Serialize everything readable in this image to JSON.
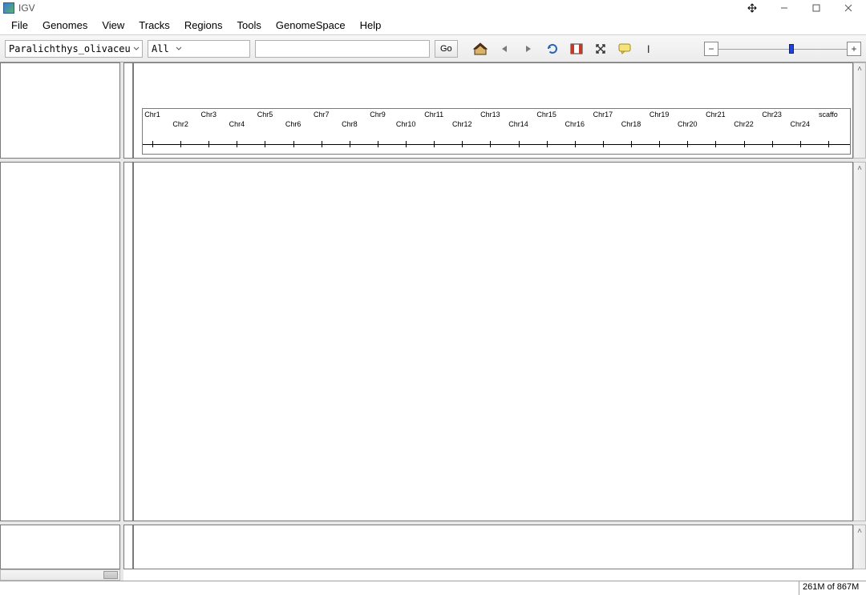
{
  "window": {
    "title": "IGV"
  },
  "menu": {
    "items": [
      "File",
      "Genomes",
      "View",
      "Tracks",
      "Regions",
      "Tools",
      "GenomeSpace",
      "Help"
    ]
  },
  "toolbar": {
    "genome_selected": "Paralichthys_olivaceus...",
    "chrom_selected": "All",
    "locus_value": "",
    "go_label": "Go"
  },
  "chromosomes": {
    "labels_row1": [
      "Chr1",
      "Chr3",
      "Chr5",
      "Chr7",
      "Chr9",
      "Chr11",
      "Chr13",
      "Chr15",
      "Chr17",
      "Chr19",
      "Chr21",
      "Chr23",
      "scaffo"
    ],
    "labels_row2": [
      "Chr2",
      "Chr4",
      "Chr6",
      "Chr8",
      "Chr10",
      "Chr12",
      "Chr14",
      "Chr16",
      "Chr18",
      "Chr20",
      "Chr22",
      "Chr24"
    ]
  },
  "status": {
    "memory": "261M of 867M"
  }
}
